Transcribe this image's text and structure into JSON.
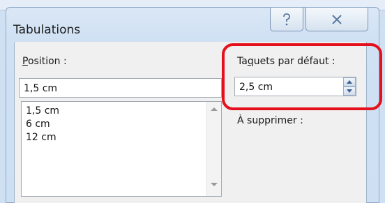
{
  "dialog": {
    "title": "Tabulations",
    "help_icon": "help-question-icon",
    "close_icon": "close-x-icon"
  },
  "position": {
    "label_first": "P",
    "label_rest": "osition :",
    "value": "1,5 cm",
    "list_items": [
      "1,5 cm",
      "6 cm",
      "12 cm"
    ]
  },
  "default_stops": {
    "label_before": "Ta",
    "label_underlined": "q",
    "label_after": "uets par défaut :",
    "value": "2,5 cm"
  },
  "to_delete_label": "À supprimer :",
  "colors": {
    "highlight": "#e4101b",
    "title_bar": "#d0e1f4"
  }
}
